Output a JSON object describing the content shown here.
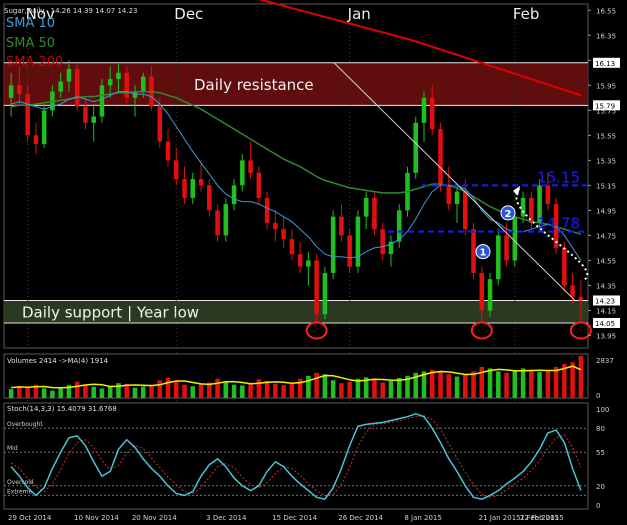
{
  "window": {
    "title": "Sugar,Daily",
    "ohlc": "14.26 14.39 14.07 14.23"
  },
  "legend": {
    "sma10": "SMA 10",
    "sma50": "SMA 50",
    "sma200": "SMA 200"
  },
  "colors": {
    "bull": "#1fbf1f",
    "bear": "#e01010",
    "sma10": "#3b9ad9",
    "sma50": "#2f8a2f",
    "sma200": "#e00000",
    "resistance_zone": "#6a0e0e",
    "support_zone": "#2c3d22",
    "level_line": "#1a1aff",
    "stochastic": "#46c4d4",
    "volume_ma": "#f0f000"
  },
  "chart_data": [
    {
      "type": "candlestick",
      "y_axis_ticks": [
        "16.55",
        "16.35",
        "16.15",
        "15.95",
        "15.75",
        "15.55",
        "15.35",
        "15.15",
        "14.95",
        "14.75",
        "14.55",
        "14.35",
        "14.15",
        "13.95"
      ],
      "ylim": [
        13.85,
        16.6
      ],
      "month_labels": [
        "Nov",
        "Dec",
        "Jan",
        "Feb"
      ],
      "zones": [
        {
          "label": "Daily resistance",
          "from": 15.79,
          "to": 16.13
        },
        {
          "label": "Daily support | Year low",
          "from": 14.05,
          "to": 14.23
        }
      ],
      "zone_edge_labels": [
        "16.13",
        "15.79",
        "14.23",
        "14.05"
      ],
      "levels": [
        {
          "label": "15.15",
          "value": 15.15
        },
        {
          "label": "14.78",
          "value": 14.78
        }
      ],
      "markers": [
        "1",
        "2"
      ],
      "price_labels": [
        "14.23",
        "14.05"
      ],
      "candles": [
        [
          15.85,
          16.05,
          15.7,
          15.95
        ],
        [
          15.95,
          16.1,
          15.8,
          15.88
        ],
        [
          15.88,
          15.95,
          15.5,
          15.55
        ],
        [
          15.55,
          15.65,
          15.4,
          15.48
        ],
        [
          15.48,
          15.8,
          15.45,
          15.75
        ],
        [
          15.75,
          15.95,
          15.7,
          15.9
        ],
        [
          15.9,
          16.05,
          15.85,
          15.98
        ],
        [
          15.98,
          16.15,
          15.9,
          16.08
        ],
        [
          16.08,
          16.12,
          15.75,
          15.78
        ],
        [
          15.78,
          15.85,
          15.6,
          15.65
        ],
        [
          15.65,
          15.8,
          15.5,
          15.7
        ],
        [
          15.7,
          16.0,
          15.65,
          15.95
        ],
        [
          15.95,
          16.1,
          15.85,
          16.0
        ],
        [
          16.0,
          16.12,
          15.9,
          16.05
        ],
        [
          16.05,
          16.1,
          15.8,
          15.85
        ],
        [
          15.85,
          15.95,
          15.7,
          15.9
        ],
        [
          15.9,
          16.05,
          15.85,
          16.02
        ],
        [
          16.02,
          16.1,
          15.75,
          15.78
        ],
        [
          15.78,
          15.85,
          15.45,
          15.5
        ],
        [
          15.5,
          15.6,
          15.3,
          15.35
        ],
        [
          15.35,
          15.45,
          15.15,
          15.2
        ],
        [
          15.2,
          15.3,
          15.0,
          15.05
        ],
        [
          15.05,
          15.25,
          15.0,
          15.2
        ],
        [
          15.2,
          15.35,
          15.1,
          15.15
        ],
        [
          15.15,
          15.2,
          14.9,
          14.95
        ],
        [
          14.95,
          15.0,
          14.7,
          14.75
        ],
        [
          14.75,
          15.05,
          14.7,
          15.0
        ],
        [
          15.0,
          15.2,
          14.95,
          15.15
        ],
        [
          15.15,
          15.4,
          15.1,
          15.35
        ],
        [
          15.35,
          15.5,
          15.2,
          15.25
        ],
        [
          15.25,
          15.3,
          15.0,
          15.05
        ],
        [
          15.05,
          15.1,
          14.8,
          14.85
        ],
        [
          14.85,
          14.95,
          14.7,
          14.8
        ],
        [
          14.8,
          14.9,
          14.65,
          14.72
        ],
        [
          14.72,
          14.8,
          14.55,
          14.6
        ],
        [
          14.6,
          14.7,
          14.45,
          14.5
        ],
        [
          14.5,
          14.62,
          14.35,
          14.55
        ],
        [
          14.55,
          14.6,
          14.05,
          14.12
        ],
        [
          14.12,
          14.5,
          14.08,
          14.45
        ],
        [
          14.45,
          14.95,
          14.4,
          14.9
        ],
        [
          14.9,
          15.0,
          14.7,
          14.75
        ],
        [
          14.75,
          14.8,
          14.45,
          14.5
        ],
        [
          14.5,
          14.95,
          14.45,
          14.9
        ],
        [
          14.9,
          15.1,
          14.8,
          15.05
        ],
        [
          15.05,
          15.1,
          14.75,
          14.8
        ],
        [
          14.8,
          14.85,
          14.55,
          14.6
        ],
        [
          14.6,
          14.75,
          14.5,
          14.7
        ],
        [
          14.7,
          15.0,
          14.65,
          14.95
        ],
        [
          14.95,
          15.3,
          14.9,
          15.25
        ],
        [
          15.25,
          15.7,
          15.2,
          15.65
        ],
        [
          15.65,
          15.9,
          15.5,
          15.85
        ],
        [
          15.85,
          15.95,
          15.55,
          15.6
        ],
        [
          15.6,
          15.65,
          15.1,
          15.15
        ],
        [
          15.15,
          15.3,
          14.95,
          15.0
        ],
        [
          15.0,
          15.15,
          14.85,
          15.1
        ],
        [
          15.1,
          15.2,
          14.75,
          14.8
        ],
        [
          14.8,
          14.85,
          14.4,
          14.45
        ],
        [
          14.45,
          14.5,
          14.05,
          14.15
        ],
        [
          14.15,
          14.45,
          14.1,
          14.4
        ],
        [
          14.4,
          14.8,
          14.35,
          14.75
        ],
        [
          14.75,
          14.85,
          14.5,
          14.55
        ],
        [
          14.55,
          14.95,
          14.5,
          14.9
        ],
        [
          14.9,
          15.1,
          14.85,
          15.05
        ],
        [
          15.05,
          15.1,
          14.8,
          14.85
        ],
        [
          14.85,
          15.2,
          14.8,
          15.15
        ],
        [
          15.15,
          15.25,
          14.95,
          15.0
        ],
        [
          15.0,
          15.05,
          14.6,
          14.65
        ],
        [
          14.65,
          14.7,
          14.3,
          14.35
        ],
        [
          14.35,
          14.45,
          14.2,
          14.26
        ],
        [
          14.26,
          14.39,
          14.07,
          14.23
        ]
      ],
      "sma10": [
        15.8,
        15.82,
        15.8,
        15.78,
        15.76,
        15.78,
        15.8,
        15.84,
        15.86,
        15.84,
        15.82,
        15.84,
        15.87,
        15.9,
        15.9,
        15.88,
        15.88,
        15.86,
        15.8,
        15.72,
        15.62,
        15.52,
        15.42,
        15.33,
        15.24,
        15.15,
        15.08,
        15.04,
        15.02,
        15.02,
        15.0,
        14.97,
        14.94,
        14.9,
        14.86,
        14.8,
        14.74,
        14.66,
        14.6,
        14.58,
        14.58,
        14.57,
        14.58,
        14.62,
        14.65,
        14.66,
        14.68,
        14.72,
        14.78,
        14.88,
        15.0,
        15.1,
        15.15,
        15.15,
        15.15,
        15.12,
        15.05,
        14.95,
        14.88,
        14.85,
        14.8,
        14.78,
        14.78,
        14.8,
        14.82,
        14.84,
        14.82,
        14.75,
        14.65,
        14.55
      ],
      "sma50": [
        15.78,
        15.79,
        15.79,
        15.8,
        15.81,
        15.82,
        15.83,
        15.84,
        15.85,
        15.86,
        15.86,
        15.87,
        15.88,
        15.89,
        15.89,
        15.9,
        15.9,
        15.9,
        15.89,
        15.87,
        15.85,
        15.82,
        15.79,
        15.76,
        15.72,
        15.68,
        15.64,
        15.6,
        15.56,
        15.52,
        15.48,
        15.44,
        15.4,
        15.36,
        15.33,
        15.3,
        15.26,
        15.22,
        15.19,
        15.17,
        15.15,
        15.13,
        15.12,
        15.11,
        15.1,
        15.09,
        15.09,
        15.09,
        15.1,
        15.12,
        15.14,
        15.16,
        15.16,
        15.15,
        15.13,
        15.1,
        15.06,
        15.02,
        14.98,
        14.95,
        14.92,
        14.9,
        14.88,
        14.86,
        14.85,
        14.84,
        14.82,
        14.8,
        14.78,
        14.76
      ],
      "sma200_labels": "SMA 200"
    },
    {
      "type": "bar",
      "title": "Volumes 2414  ->MA(4) 1914",
      "y_axis_ticks": [
        "2837",
        "0"
      ],
      "ylim": [
        0,
        2837
      ],
      "values": [
        600,
        800,
        700,
        900,
        650,
        500,
        720,
        880,
        1100,
        900,
        760,
        640,
        820,
        1000,
        950,
        700,
        780,
        900,
        1200,
        1350,
        1150,
        900,
        800,
        950,
        1050,
        1300,
        1100,
        900,
        850,
        1000,
        1250,
        1150,
        960,
        870,
        1050,
        1300,
        1500,
        1700,
        1600,
        1200,
        1000,
        1100,
        1300,
        1400,
        1250,
        1050,
        1150,
        1350,
        1500,
        1700,
        1800,
        1900,
        1750,
        1600,
        1450,
        1550,
        1800,
        2100,
        2000,
        1800,
        1700,
        1850,
        2000,
        1900,
        1750,
        1800,
        2100,
        2300,
        2414,
        2837
      ],
      "ma4": [
        700,
        750,
        720,
        760,
        780,
        700,
        690,
        710,
        800,
        880,
        930,
        900,
        780,
        800,
        860,
        880,
        860,
        840,
        890,
        1040,
        1150,
        1150,
        1050,
        950,
        920,
        990,
        1100,
        1110,
        1050,
        960,
        990,
        1060,
        1090,
        1060,
        990,
        1040,
        1160,
        1340,
        1520,
        1500,
        1370,
        1230,
        1150,
        1200,
        1260,
        1250,
        1210,
        1200,
        1260,
        1420,
        1580,
        1720,
        1790,
        1760,
        1680,
        1590,
        1600,
        1730,
        1860,
        1930,
        1900,
        1840,
        1840,
        1860,
        1880,
        1860,
        1860,
        1990,
        2150,
        1914
      ]
    },
    {
      "type": "line",
      "title": "Stoch(14,3,3) 15.4079 31.6768",
      "y_axis_ticks": [
        "100",
        "80",
        "55",
        "20",
        "0"
      ],
      "ylim": [
        0,
        100
      ],
      "level_labels": [
        "Overbought",
        "Mid",
        "Oversold",
        "Extreme"
      ],
      "levels": [
        80,
        55,
        20,
        10
      ],
      "k": [
        40,
        30,
        18,
        10,
        18,
        38,
        55,
        70,
        72,
        62,
        45,
        30,
        35,
        58,
        68,
        60,
        48,
        38,
        30,
        20,
        12,
        10,
        14,
        30,
        42,
        48,
        40,
        28,
        20,
        15,
        20,
        35,
        45,
        40,
        30,
        22,
        15,
        8,
        6,
        18,
        38,
        62,
        82,
        84,
        85,
        86,
        88,
        90,
        92,
        95,
        92,
        80,
        65,
        48,
        35,
        20,
        8,
        6,
        10,
        15,
        22,
        28,
        35,
        45,
        58,
        75,
        78,
        65,
        38,
        15
      ],
      "d": [
        44,
        38,
        28,
        19,
        14,
        22,
        37,
        54,
        65,
        68,
        60,
        46,
        37,
        41,
        54,
        62,
        59,
        49,
        39,
        29,
        21,
        14,
        12,
        18,
        29,
        40,
        43,
        39,
        29,
        21,
        18,
        23,
        33,
        40,
        38,
        31,
        22,
        15,
        10,
        11,
        21,
        39,
        61,
        76,
        84,
        85,
        86,
        88,
        90,
        92,
        93,
        89,
        79,
        64,
        49,
        34,
        21,
        11,
        8,
        10,
        16,
        22,
        28,
        36,
        46,
        59,
        70,
        73,
        60,
        39
      ],
      "x_tick_labels": [
        "29 Oct 2014",
        "10 Nov 2014",
        "20 Nov 2014",
        "3 Dec 2014",
        "15 Dec 2014",
        "26 Dec 2014",
        "8 Jan 2015",
        "21 Jan 2015",
        "2 Feb 2015",
        "12 Feb 2015"
      ]
    }
  ]
}
